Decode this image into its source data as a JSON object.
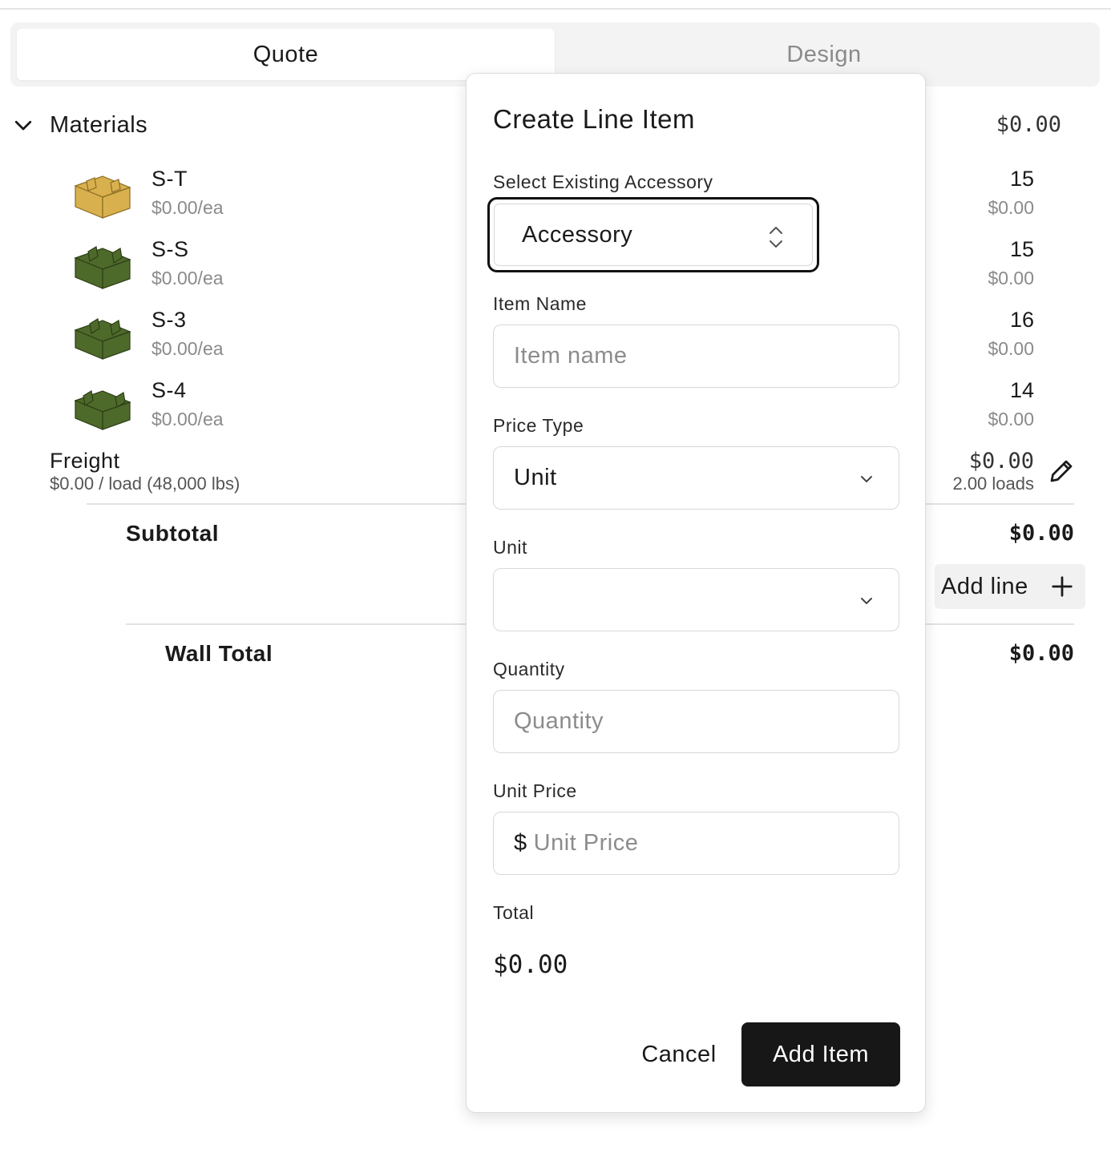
{
  "tabs": [
    {
      "label": "Quote",
      "active": true
    },
    {
      "label": "Design",
      "active": false
    }
  ],
  "materials": {
    "title": "Materials",
    "total": "$0.00",
    "items": [
      {
        "name": "S-T",
        "price": "$0.00/ea",
        "qty": "15",
        "amount": "$0.00",
        "color": "#d8b04e"
      },
      {
        "name": "S-S",
        "price": "$0.00/ea",
        "qty": "15",
        "amount": "$0.00",
        "color": "#4e6a2a"
      },
      {
        "name": "S-3",
        "price": "$0.00/ea",
        "qty": "16",
        "amount": "$0.00",
        "color": "#4e6a2a"
      },
      {
        "name": "S-4",
        "price": "$0.00/ea",
        "qty": "14",
        "amount": "$0.00",
        "color": "#4e6a2a"
      }
    ]
  },
  "freight": {
    "name": "Freight",
    "rate": "$0.00 / load (48,000 lbs)",
    "amount": "$0.00",
    "loads": "2.00 loads"
  },
  "subtotal": {
    "label": "Subtotal",
    "value": "$0.00"
  },
  "add_line": {
    "label": "Add line"
  },
  "wall_total": {
    "label": "Wall Total",
    "value": "$0.00"
  },
  "modal": {
    "title": "Create Line Item",
    "accessory": {
      "label": "Select Existing Accessory",
      "value": "Accessory"
    },
    "item_name": {
      "label": "Item Name",
      "placeholder": "Item name",
      "value": ""
    },
    "price_type": {
      "label": "Price Type",
      "value": "Unit"
    },
    "unit": {
      "label": "Unit",
      "value": ""
    },
    "quantity": {
      "label": "Quantity",
      "placeholder": "Quantity",
      "value": ""
    },
    "unit_price": {
      "label": "Unit Price",
      "currency": "$",
      "placeholder": "Unit Price",
      "value": ""
    },
    "total": {
      "label": "Total",
      "value": "$0.00"
    },
    "cancel_label": "Cancel",
    "add_label": "Add Item"
  },
  "colors": {
    "primary_button": "#171717",
    "accent_border": "#111111",
    "muted_text": "#8a8a8a"
  },
  "icons": [
    "chevron-down-icon",
    "pencil-icon",
    "plus-icon",
    "up-down-chevron-icon"
  ]
}
